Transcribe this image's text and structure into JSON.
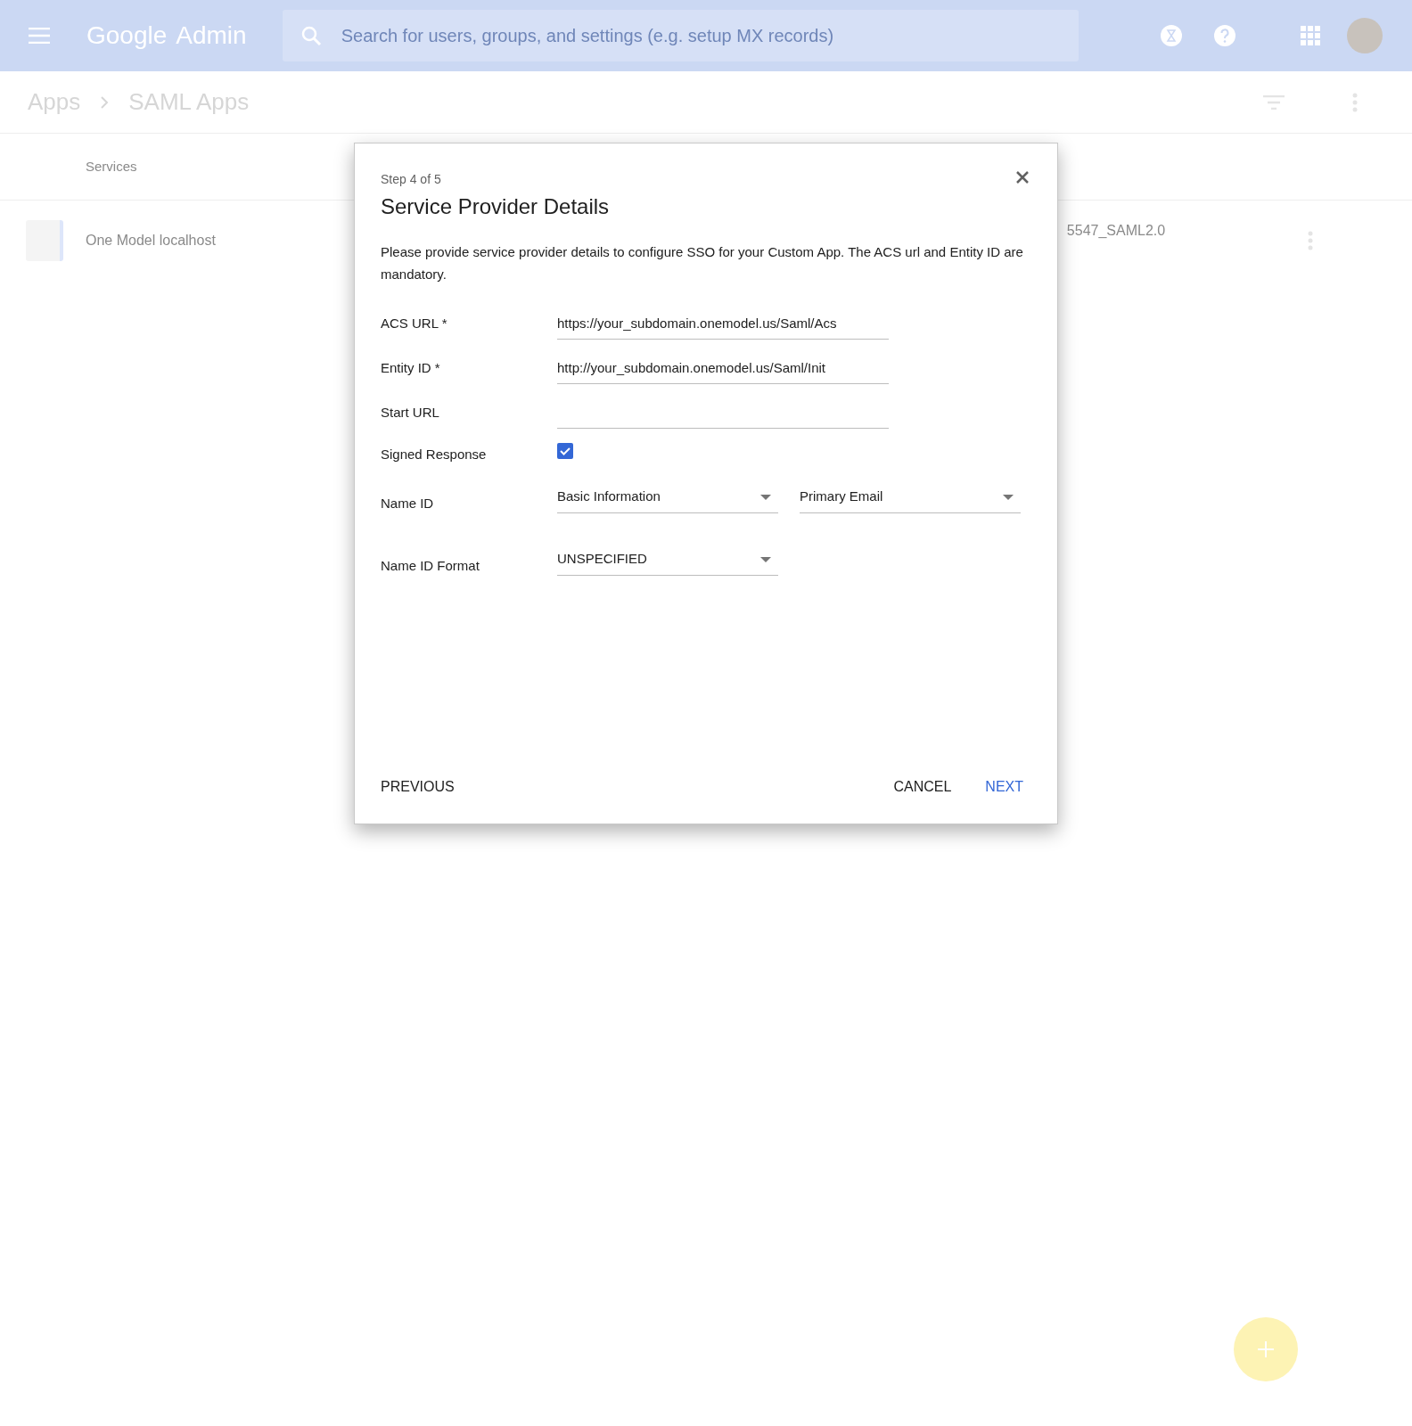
{
  "header": {
    "logo": "Google",
    "product": "Admin",
    "search": {
      "placeholder": "Search for users, groups, and settings (e.g. setup MX records)"
    }
  },
  "breadcrumb": [
    "Apps",
    "SAML Apps"
  ],
  "table": {
    "columns": [
      "Services"
    ],
    "rows": [
      {
        "name": "One Model localhost",
        "column_2": "5547_SAML2.0"
      }
    ]
  },
  "dialog": {
    "step": "Step 4 of 5",
    "title": "Service Provider Details",
    "description": "Please provide service provider details to configure SSO for your Custom App. The ACS url and Entity ID are mandatory.",
    "fields": [
      {
        "kind": "text",
        "label": "ACS URL *",
        "value": "https://your_subdomain.onemodel.us/Saml/Acs"
      },
      {
        "kind": "text",
        "label": "Entity ID *",
        "value": "http://your_subdomain.onemodel.us/Saml/Init"
      },
      {
        "kind": "text",
        "label": "Start URL"
      },
      {
        "kind": "checkbox",
        "label": "Signed Response",
        "checked": true
      },
      {
        "kind": "select",
        "label": "Name ID",
        "options": [
          "Basic Information",
          "Primary Email"
        ]
      },
      {
        "kind": "select",
        "label": "Name ID Format",
        "options": [
          "UNSPECIFIED"
        ]
      }
    ],
    "buttons": {
      "previous": "PREVIOUS",
      "cancel": "CANCEL",
      "next": "NEXT"
    }
  }
}
